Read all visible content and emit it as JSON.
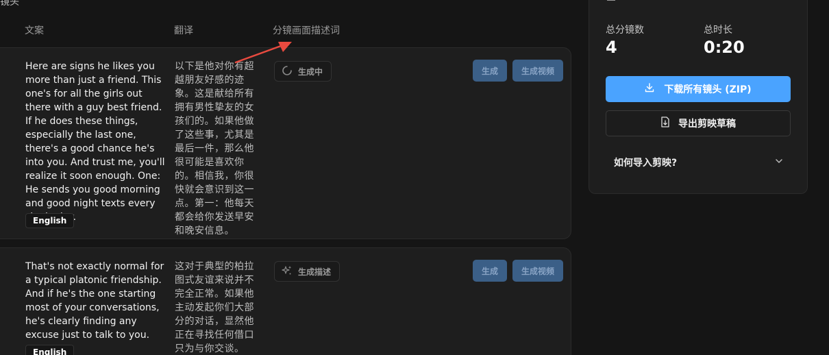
{
  "header": {
    "section_title_cut": "镜头",
    "columns": {
      "script": "文案",
      "translation": "翻译",
      "storyboard": "分镜画面描述词"
    }
  },
  "rows": [
    {
      "text": "Here are signs he likes you more than just a friend. This one's for all the girls out there with a guy best friend. If he does these things, especially the last one, there's a good chance he's into you. And trust me, you'll realize it soon enough. One: He sends you good morning and good night texts every single day.",
      "language": "English",
      "translation": "以下是他对你有超越朋友好感的迹象。这是献给所有拥有男性挚友的女孩们的。如果他做了这些事，尤其是最后一件，那么他很可能是喜欢你的。相信我，你很快就会意识到这一点。第一：他每天都会给你发送早安和晚安信息。",
      "status": {
        "label": "生成中",
        "icon": "spinner-icon"
      },
      "generate_label": "生成",
      "generate_video_label": "生成视频"
    },
    {
      "text": "That's not exactly normal for a typical platonic friendship. And if he's the one starting most of your conversations, he's clearly finding any excuse just to talk to you.",
      "language": "English",
      "translation": "这对于典型的柏拉图式友谊来说并不完全正常。如果他主动发起你们大部分的对话，显然他正在寻找任何借口只为与你交谈。",
      "status": {
        "label": "生成描述",
        "icon": "sparkles-icon"
      },
      "generate_label": "生成",
      "generate_video_label": "生成视频"
    }
  ],
  "summary": {
    "total_shots_label": "总分镜数",
    "total_shots_value": "4",
    "total_duration_label": "总时长",
    "total_duration_value": "0:20",
    "download_label": "下载所有镜头 (ZIP)",
    "export_label": "导出剪映草稿",
    "howto_label": "如何导入剪映?"
  },
  "colors": {
    "accent": "#4aa3ff",
    "disabled_button": "#3b5f87",
    "annotation_arrow": "#e84a3f"
  }
}
